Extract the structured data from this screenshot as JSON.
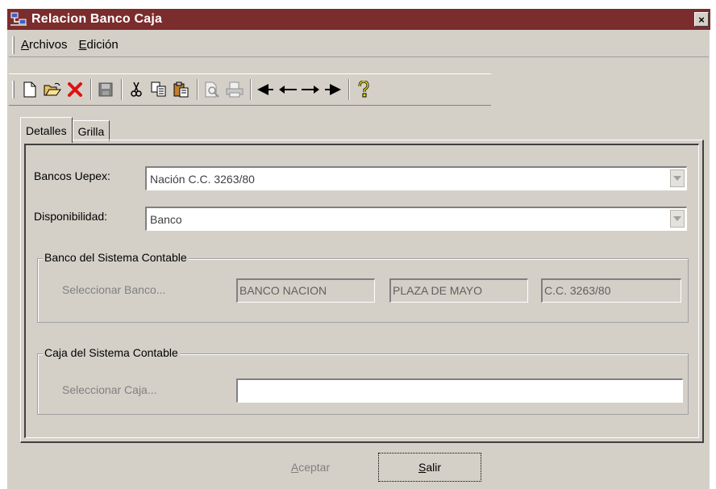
{
  "window": {
    "title": "Relacion Banco Caja",
    "close_label": "×"
  },
  "menu": {
    "items": [
      {
        "accel": "A",
        "rest": "rchivos"
      },
      {
        "accel": "E",
        "rest": "dición"
      }
    ]
  },
  "toolbar": {
    "buttons": [
      "new-document-icon",
      "open-folder-icon",
      "delete-icon",
      "save-icon",
      "cut-icon",
      "copy-icon",
      "paste-icon",
      "print-preview-icon",
      "print-icon",
      "first-record-icon",
      "previous-record-icon",
      "next-record-icon",
      "last-record-icon",
      "help-icon"
    ]
  },
  "tabs": [
    {
      "label": "Detalles"
    },
    {
      "label": "Grilla"
    }
  ],
  "form": {
    "bancos_label": "Bancos Uepex:",
    "bancos_value": "Nación C.C. 3263/80",
    "disponibilidad_label": "Disponibilidad:",
    "disponibilidad_value": "Banco",
    "banco_group": {
      "legend": "Banco del Sistema Contable",
      "select_label": "Seleccionar Banco...",
      "field1": "BANCO NACION",
      "field2": "PLAZA DE MAYO",
      "field3": "C.C. 3263/80"
    },
    "caja_group": {
      "legend": "Caja del Sistema Contable",
      "select_label": "Seleccionar Caja...",
      "field1": ""
    }
  },
  "buttons": {
    "aceptar": {
      "accel": "A",
      "rest": "ceptar"
    },
    "salir": {
      "accel": "S",
      "rest": "alir"
    }
  }
}
